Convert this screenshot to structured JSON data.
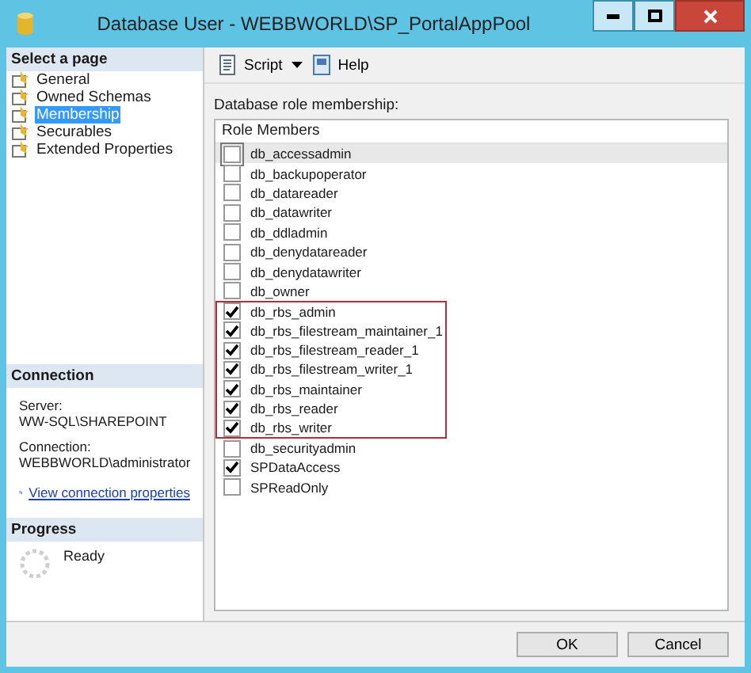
{
  "window": {
    "title": "Database User - WEBBWORLD\\SP_PortalAppPool"
  },
  "sidebar": {
    "heading": "Select a page",
    "items": [
      {
        "label": "General",
        "selected": false
      },
      {
        "label": "Owned Schemas",
        "selected": false
      },
      {
        "label": "Membership",
        "selected": true
      },
      {
        "label": "Securables",
        "selected": false
      },
      {
        "label": "Extended Properties",
        "selected": false
      }
    ]
  },
  "connection": {
    "heading": "Connection",
    "server_label": "Server:",
    "server": "WW-SQL\\SHAREPOINT",
    "connection_label": "Connection:",
    "connection": "WEBBWORLD\\administrator",
    "link": "View connection properties"
  },
  "progress": {
    "heading": "Progress",
    "status": "Ready"
  },
  "toolbar": {
    "script": "Script",
    "help": "Help"
  },
  "membership": {
    "label": "Database role membership:",
    "column": "Role Members",
    "rows": [
      {
        "name": "db_accessadmin",
        "checked": false,
        "selected": true,
        "highlighted": false
      },
      {
        "name": "db_backupoperator",
        "checked": false,
        "selected": false,
        "highlighted": false
      },
      {
        "name": "db_datareader",
        "checked": false,
        "selected": false,
        "highlighted": false
      },
      {
        "name": "db_datawriter",
        "checked": false,
        "selected": false,
        "highlighted": false
      },
      {
        "name": "db_ddladmin",
        "checked": false,
        "selected": false,
        "highlighted": false
      },
      {
        "name": "db_denydatareader",
        "checked": false,
        "selected": false,
        "highlighted": false
      },
      {
        "name": "db_denydatawriter",
        "checked": false,
        "selected": false,
        "highlighted": false
      },
      {
        "name": "db_owner",
        "checked": false,
        "selected": false,
        "highlighted": false
      },
      {
        "name": "db_rbs_admin",
        "checked": true,
        "selected": false,
        "highlighted": true
      },
      {
        "name": "db_rbs_filestream_maintainer_1",
        "checked": true,
        "selected": false,
        "highlighted": true
      },
      {
        "name": "db_rbs_filestream_reader_1",
        "checked": true,
        "selected": false,
        "highlighted": true
      },
      {
        "name": "db_rbs_filestream_writer_1",
        "checked": true,
        "selected": false,
        "highlighted": true
      },
      {
        "name": "db_rbs_maintainer",
        "checked": true,
        "selected": false,
        "highlighted": true
      },
      {
        "name": "db_rbs_reader",
        "checked": true,
        "selected": false,
        "highlighted": true
      },
      {
        "name": "db_rbs_writer",
        "checked": true,
        "selected": false,
        "highlighted": true
      },
      {
        "name": "db_securityadmin",
        "checked": false,
        "selected": false,
        "highlighted": false
      },
      {
        "name": "SPDataAccess",
        "checked": true,
        "selected": false,
        "highlighted": false
      },
      {
        "name": "SPReadOnly",
        "checked": false,
        "selected": false,
        "highlighted": false
      }
    ]
  },
  "buttons": {
    "ok": "OK",
    "cancel": "Cancel"
  }
}
